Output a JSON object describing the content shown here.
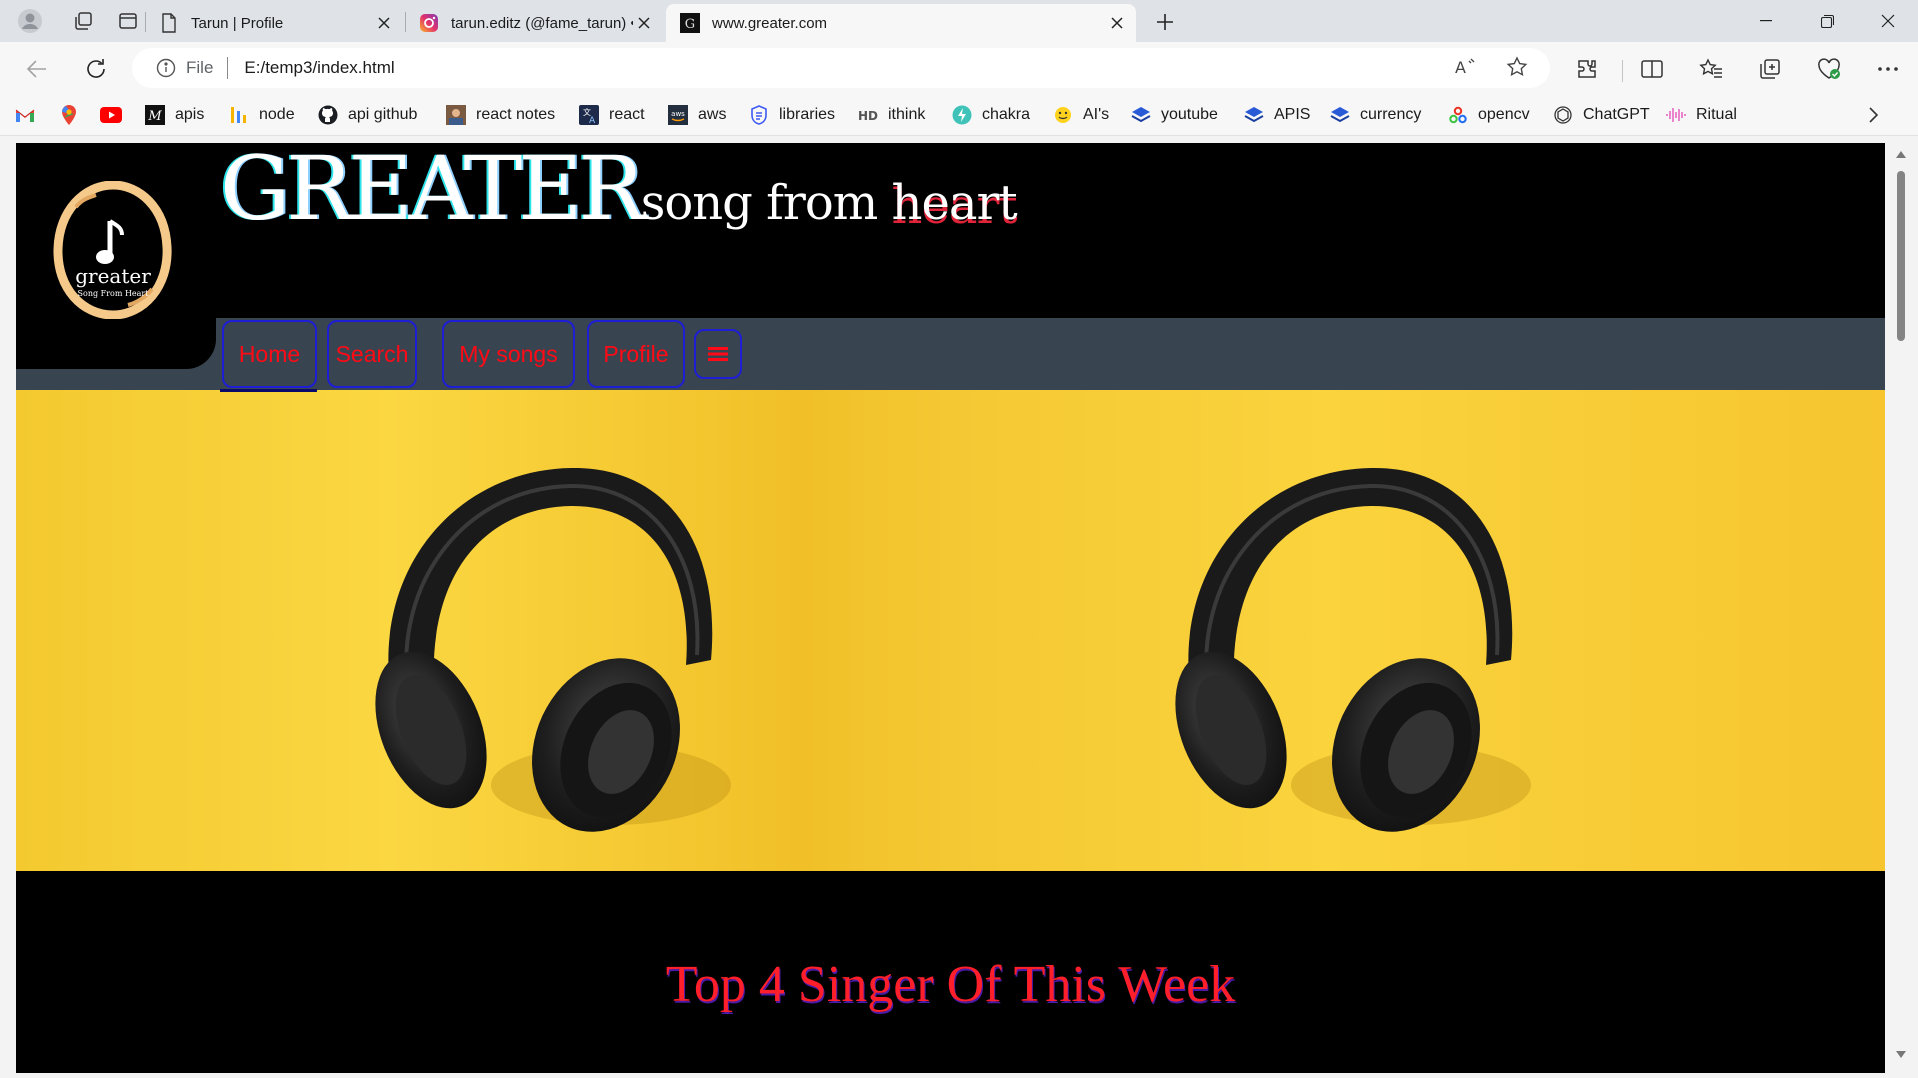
{
  "browser": {
    "tabs": [
      {
        "title": "Tarun | Profile",
        "favicon": "document-icon",
        "active": false
      },
      {
        "title": "tarun.editz (@fame_tarun) • Insta",
        "favicon": "instagram-icon",
        "active": false
      },
      {
        "title": "www.greater.com",
        "favicon": "greater-g-icon",
        "active": true
      }
    ],
    "address": {
      "scheme_label": "File",
      "url": "E:/temp3/index.html"
    },
    "bookmarks": [
      {
        "label": "",
        "icon": "gmail-icon"
      },
      {
        "label": "",
        "icon": "maps-icon"
      },
      {
        "label": "",
        "icon": "youtube-icon"
      },
      {
        "label": "apis",
        "icon": "medium-icon"
      },
      {
        "label": "node",
        "icon": "bars-icon"
      },
      {
        "label": "api github",
        "icon": "github-icon"
      },
      {
        "label": "react notes",
        "icon": "avatar-icon"
      },
      {
        "label": "react",
        "icon": "translate-icon"
      },
      {
        "label": "aws",
        "icon": "aws-icon"
      },
      {
        "label": "libraries",
        "icon": "shield-doc-icon"
      },
      {
        "label": "ithink",
        "icon": "hd-icon"
      },
      {
        "label": "chakra",
        "icon": "bolt-icon"
      },
      {
        "label": "AI's",
        "icon": "hug-icon"
      },
      {
        "label": "youtube",
        "icon": "layers-icon"
      },
      {
        "label": "APIS",
        "icon": "layers-icon"
      },
      {
        "label": "currency",
        "icon": "layers-icon"
      },
      {
        "label": "opencv",
        "icon": "opencv-icon"
      },
      {
        "label": "ChatGPT",
        "icon": "openai-icon"
      },
      {
        "label": "Ritual",
        "icon": "waveform-icon"
      }
    ]
  },
  "site": {
    "logo": {
      "name": "greater",
      "tagline": "Song From Heart"
    },
    "title_big": "GREATER",
    "title_small_pre": "song from ",
    "title_small_post": "heart",
    "nav": [
      {
        "label": "Home"
      },
      {
        "label": "Search"
      },
      {
        "label": "My songs"
      },
      {
        "label": "Profile"
      }
    ],
    "section_title": "Top 4 Singer Of This Week"
  },
  "colors": {
    "nav_text": "#ff0a16",
    "nav_border": "#1e1ed6",
    "navbar_bg": "#38444f",
    "hero_bg": "#f7c935"
  }
}
